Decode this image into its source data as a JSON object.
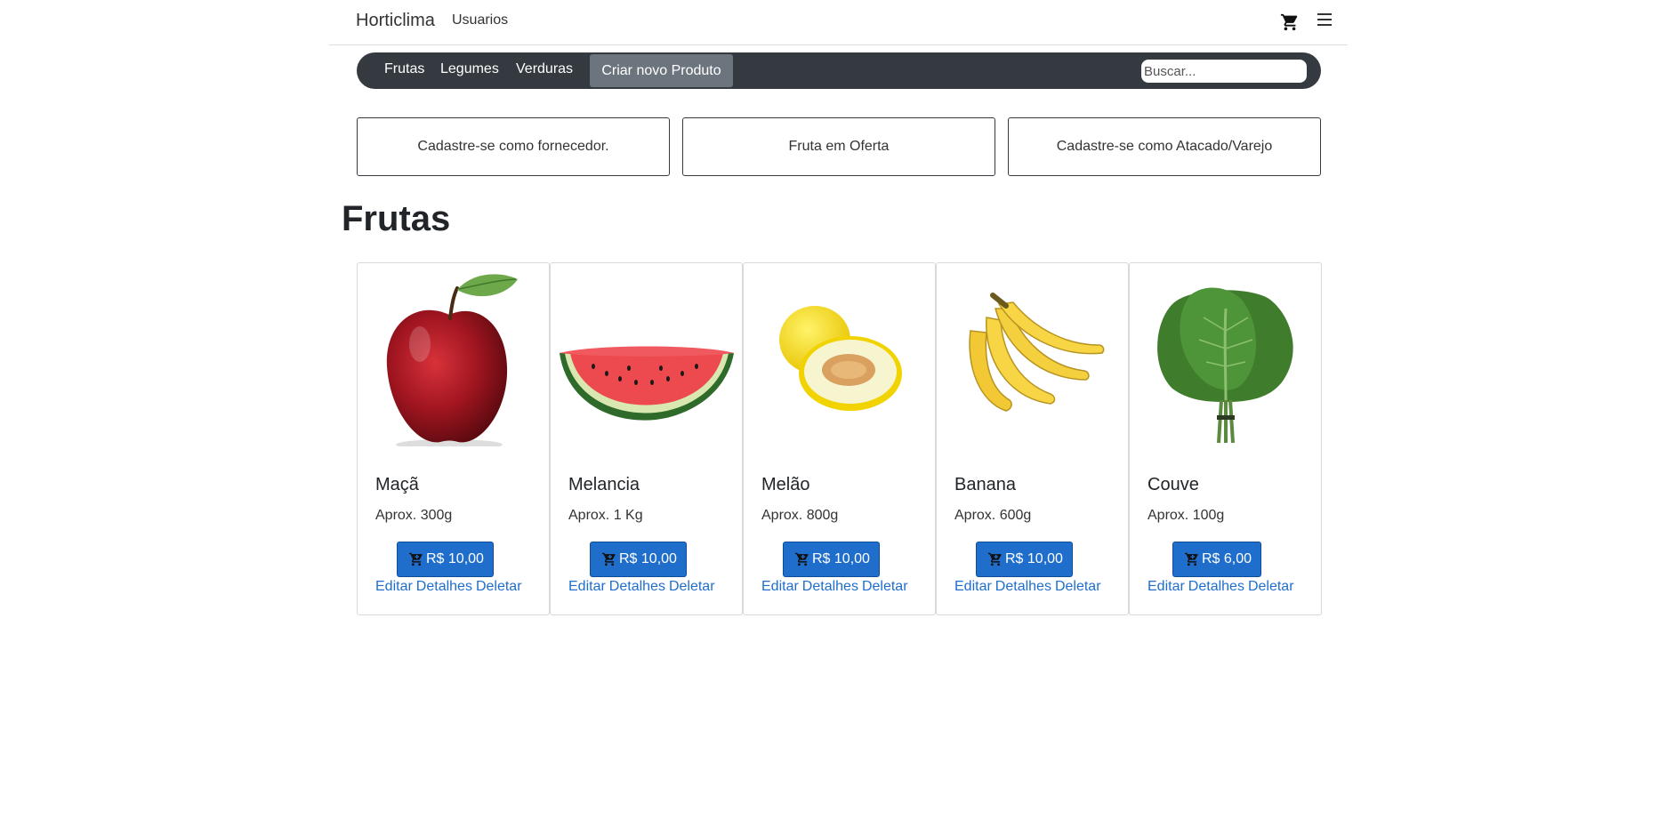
{
  "header": {
    "brand": "Horticlima",
    "nav_users": "Usuarios",
    "icons": {
      "cart": "cart-icon",
      "menu": "hamburger-menu-icon"
    }
  },
  "catbar": {
    "items": [
      "Frutas",
      "Legumes",
      "Verduras"
    ],
    "new_product": "Criar novo Produto",
    "search_placeholder": "Buscar..."
  },
  "promos": [
    "Cadastre-se como fornecedor.",
    "Fruta em Oferta",
    "Cadastre-se como Atacado/Varejo"
  ],
  "section_title": "Frutas",
  "products": [
    {
      "name": "Maçã",
      "weight": "Aprox. 300g",
      "price": "R$ 10,00",
      "image": "apple"
    },
    {
      "name": "Melancia",
      "weight": "Aprox. 1 Kg",
      "price": "R$ 10,00",
      "image": "watermelon"
    },
    {
      "name": "Melão",
      "weight": "Aprox. 800g",
      "price": "R$ 10,00",
      "image": "melon"
    },
    {
      "name": "Banana",
      "weight": "Aprox. 600g",
      "price": "R$ 10,00",
      "image": "banana"
    },
    {
      "name": "Couve",
      "weight": "Aprox. 100g",
      "price": "R$ 6,00",
      "image": "kale"
    }
  ],
  "card_links": {
    "edit": "Editar",
    "details": "Detalhes",
    "delete": "Deletar"
  },
  "colors": {
    "primary": "#1f6ecc",
    "dark_bar": "#343a40",
    "secondary": "#6c757d"
  }
}
